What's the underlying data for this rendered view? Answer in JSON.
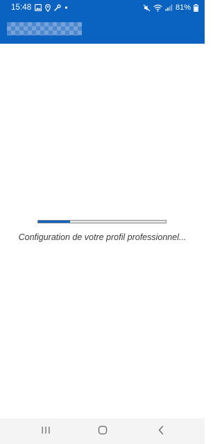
{
  "status_bar": {
    "time": "15:48",
    "battery": "81%",
    "icons_left": [
      "gallery-icon",
      "location-icon",
      "wrench-icon",
      "dot-icon"
    ],
    "icons_right": [
      "mute-icon",
      "wifi-icon",
      "signal-icon",
      "battery-icon"
    ]
  },
  "app_bar": {
    "title_redacted": true
  },
  "loading": {
    "progress_percent": 25,
    "message": "Configuration de votre profil professionnel..."
  },
  "nav_bar": {
    "buttons": [
      "recents-icon",
      "home-icon",
      "back-icon"
    ]
  },
  "colors": {
    "accent": "#0b63c1",
    "track": "#e6e6e6",
    "text": "#3a3a3a",
    "nav_bg": "#f4f4f4"
  }
}
